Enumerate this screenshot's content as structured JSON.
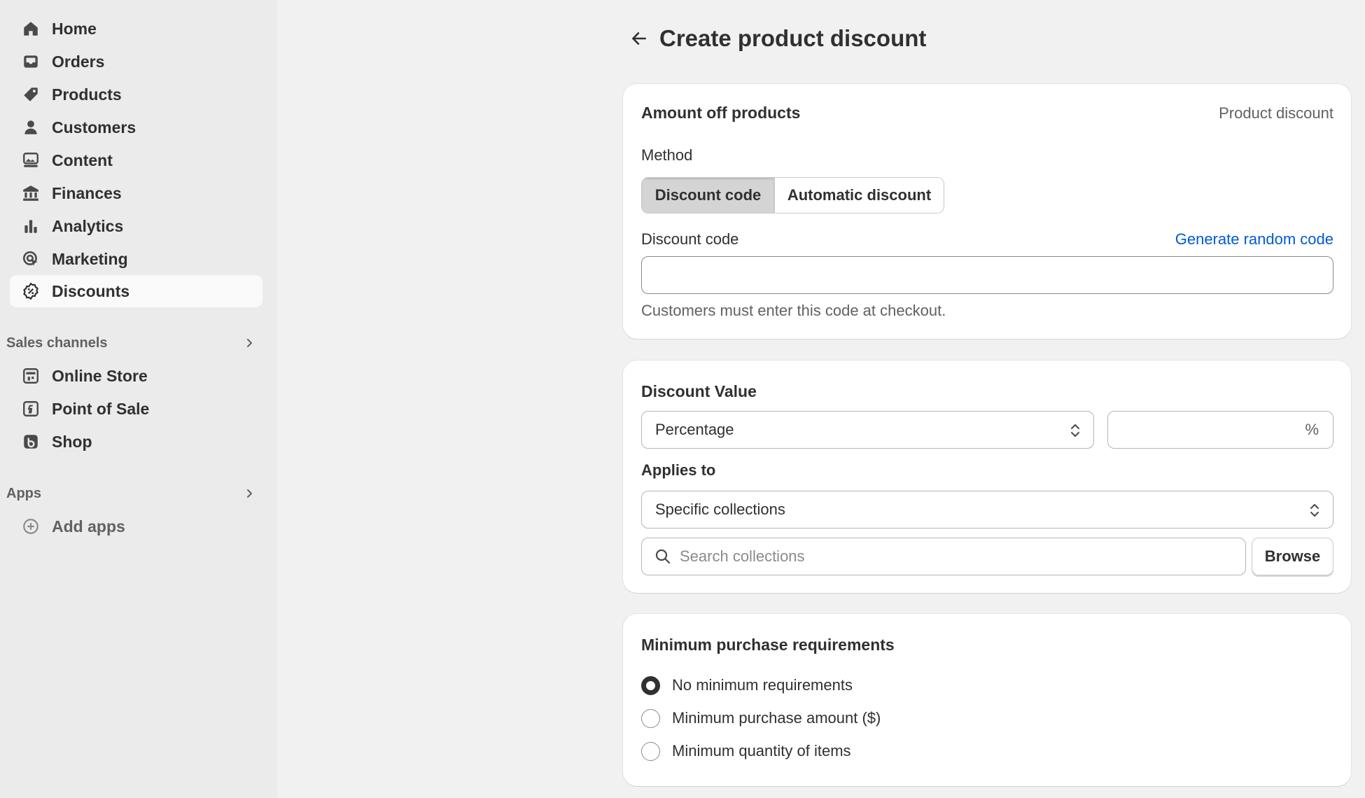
{
  "sidebar": {
    "items": [
      {
        "label": "Home",
        "icon": "home-icon"
      },
      {
        "label": "Orders",
        "icon": "inbox-icon"
      },
      {
        "label": "Products",
        "icon": "tag-icon"
      },
      {
        "label": "Customers",
        "icon": "person-icon"
      },
      {
        "label": "Content",
        "icon": "image-icon"
      },
      {
        "label": "Finances",
        "icon": "bank-icon"
      },
      {
        "label": "Analytics",
        "icon": "bar-chart-icon"
      },
      {
        "label": "Marketing",
        "icon": "target-icon"
      },
      {
        "label": "Discounts",
        "icon": "discount-icon",
        "active": true
      }
    ],
    "sales_channels": {
      "title": "Sales channels",
      "items": [
        {
          "label": "Online Store",
          "icon": "store-icon"
        },
        {
          "label": "Point of Sale",
          "icon": "pos-icon"
        },
        {
          "label": "Shop",
          "icon": "shop-icon"
        }
      ]
    },
    "apps": {
      "title": "Apps",
      "items": [
        {
          "label": "Add apps",
          "icon": "plus-circle-icon"
        }
      ]
    }
  },
  "header": {
    "title": "Create product discount"
  },
  "card_amount": {
    "title": "Amount off products",
    "type_label": "Product discount",
    "method_label": "Method",
    "method_options": [
      "Discount code",
      "Automatic discount"
    ],
    "method_selected": "Discount code",
    "code_label": "Discount code",
    "generate_link": "Generate random code",
    "code_value": "",
    "help_text": "Customers must enter this code at checkout."
  },
  "card_value": {
    "title": "Discount Value",
    "value_type": "Percentage",
    "value_amount": "",
    "value_suffix": "%",
    "applies_label": "Applies to",
    "applies_value": "Specific collections",
    "search_placeholder": "Search collections",
    "browse_label": "Browse"
  },
  "card_min": {
    "title": "Minimum purchase requirements",
    "options": [
      {
        "label": "No minimum requirements",
        "checked": true
      },
      {
        "label": "Minimum purchase amount ($)",
        "checked": false
      },
      {
        "label": "Minimum quantity of items",
        "checked": false
      }
    ]
  },
  "colors": {
    "link": "#005bd3",
    "sidebar_bg": "#ebebeb",
    "page_bg": "#f1f1f1"
  }
}
